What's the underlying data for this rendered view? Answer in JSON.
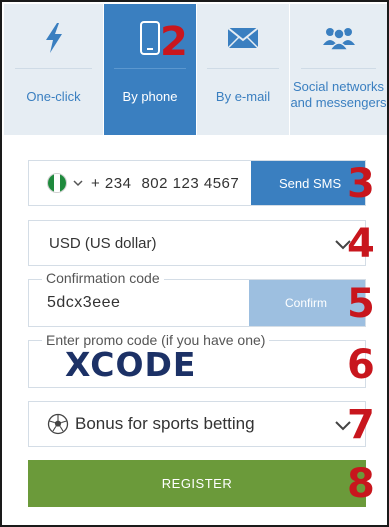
{
  "tabs": [
    {
      "label": "One-click",
      "icon": "lightning-icon",
      "active": false
    },
    {
      "label": "By phone",
      "icon": "phone-icon",
      "active": true
    },
    {
      "label": "By e-mail",
      "icon": "envelope-icon",
      "active": false
    },
    {
      "label": "Social networks and messengers",
      "icon": "people-icon",
      "active": false
    }
  ],
  "phone": {
    "flag": "nigeria-flag",
    "code": "+ 234",
    "number": "802 123 4567",
    "send_label": "Send SMS"
  },
  "currency": {
    "value": "USD (US dollar)"
  },
  "confirmation": {
    "label": "Confirmation code",
    "value": "5dcx3eee",
    "button_label": "Confirm"
  },
  "promo": {
    "label": "Enter promo code (if you have one)",
    "value": "XCODE"
  },
  "bonus": {
    "value": "Bonus for sports betting",
    "icon": "soccer-ball-icon"
  },
  "register": {
    "label": "REGISTER"
  },
  "step_numbers": {
    "n2": "2",
    "n3": "3",
    "n4": "4",
    "n5": "5",
    "n6": "6",
    "n7": "7",
    "n8": "8"
  },
  "colors": {
    "accent": "#3a7fc0",
    "accent_light": "#9dbfe0",
    "tab_bg": "#e6edf3",
    "register": "#6b9a3a",
    "step_number": "#c8161d",
    "promo_text": "#1c3166"
  }
}
